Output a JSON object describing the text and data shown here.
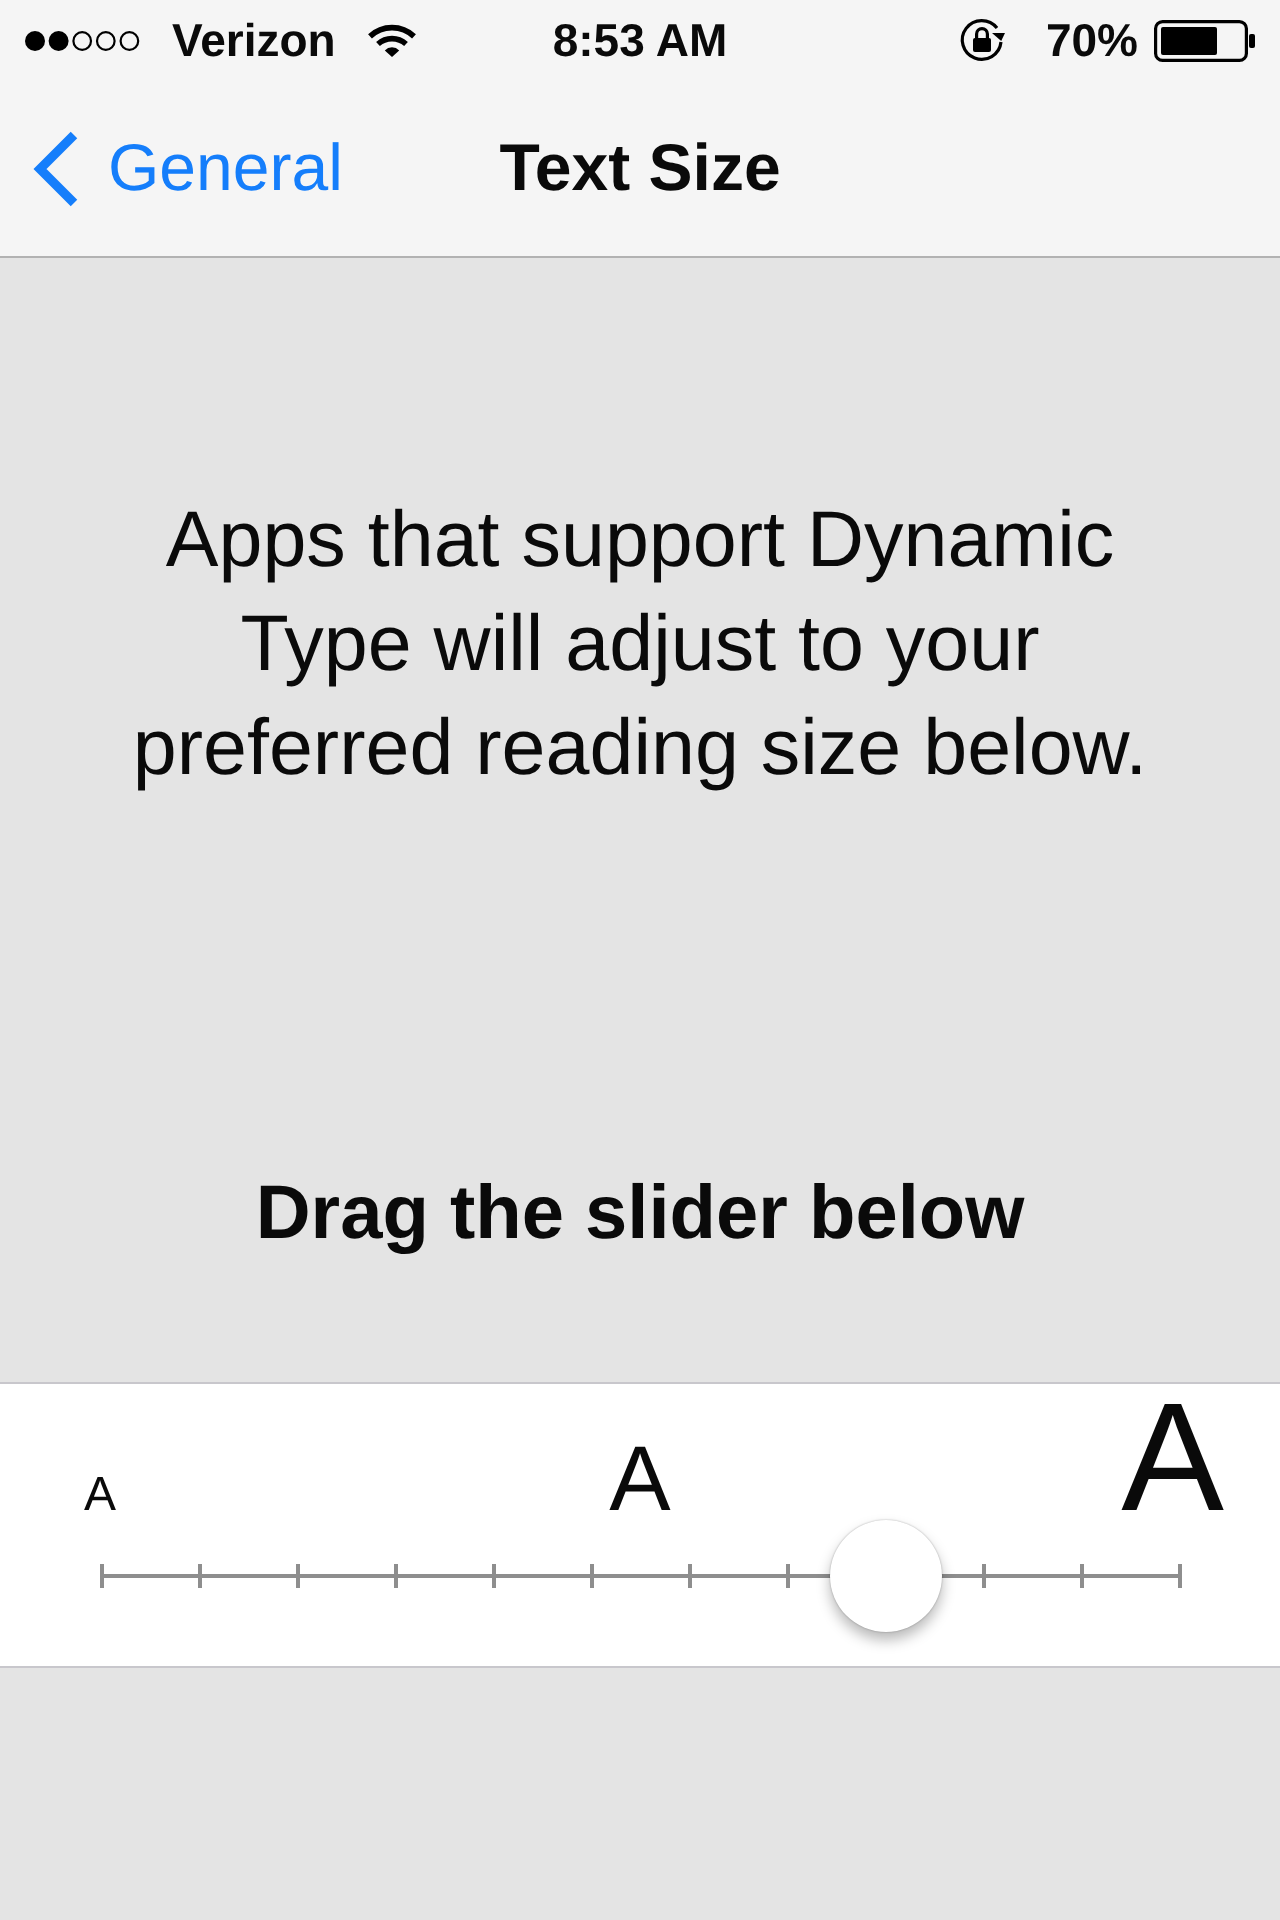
{
  "status_bar": {
    "carrier": "Verizon",
    "time": "8:53 AM",
    "battery": "70%"
  },
  "nav_bar": {
    "back_label": "General",
    "title": "Text Size"
  },
  "description": "Apps that support Dynamic Type will adjust to your preferred reading size below.",
  "instruction": "Drag the slider below",
  "slider": {
    "labels": [
      "A",
      "A",
      "A"
    ],
    "level": 0.7273
  }
}
